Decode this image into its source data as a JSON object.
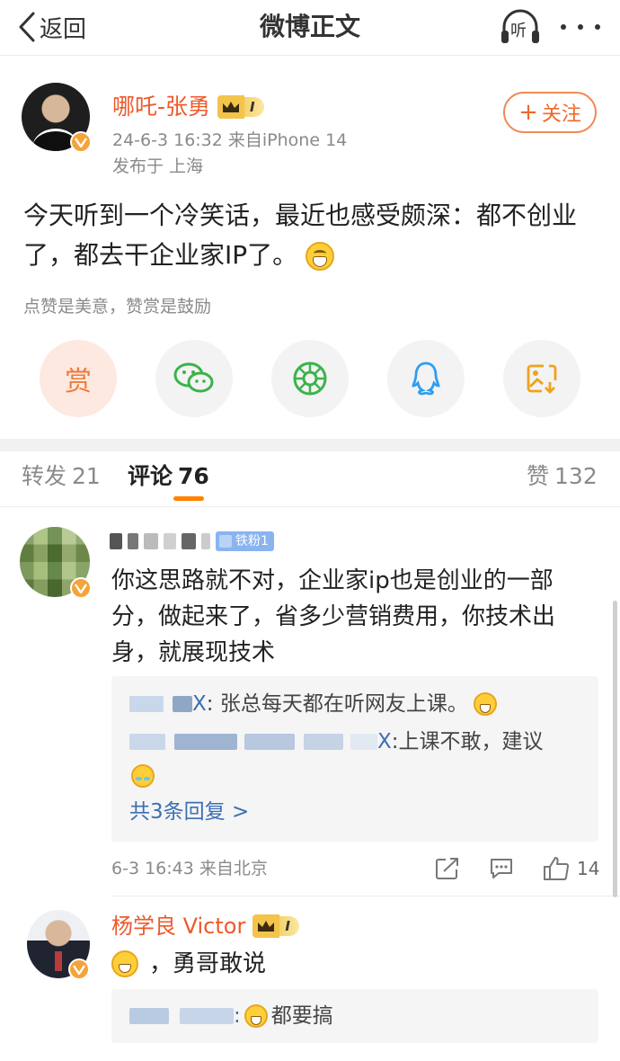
{
  "navbar": {
    "back_label": "返回",
    "title": "微博正文",
    "listen_label": "听"
  },
  "post": {
    "author": "哪吒-张勇",
    "level_badge": "I",
    "follow_label": "关注",
    "meta": "24-6-3 16:32  来自iPhone 14",
    "location": "发布于 上海",
    "body": "今天听到一个冷笑话，最近也感受颇深：都不创业了，都去干企业家IP了。",
    "reward_hint": "点赞是美意，赞赏是鼓励"
  },
  "share": {
    "reward_label": "赏",
    "items": [
      "wechat-icon",
      "moments-icon",
      "qq-icon",
      "save-image-icon"
    ]
  },
  "tabs": {
    "repost_label": "转发",
    "repost_count": "21",
    "comment_label": "评论",
    "comment_count": "76",
    "like_label": "赞",
    "like_count": "132"
  },
  "comments": [
    {
      "fan_badge": "铁粉1",
      "text": "你这思路就不对，企业家ip也是创业的一部分，做起来了，省多少营销费用，你技术出身，就展现技术",
      "replies": [
        {
          "name_tail": "X",
          "text": ": 张总每天都在听网友上课。"
        },
        {
          "name_tail": "X",
          "text": ":上课不敢，建议"
        }
      ],
      "more_replies": "共3条回复 >",
      "meta": "6-3 16:43  来自北京",
      "likes": "14"
    },
    {
      "author": "杨学良 Victor",
      "level_badge": "I",
      "text": "，勇哥敢说",
      "reply": {
        "text": "都要搞"
      }
    }
  ],
  "colors": {
    "accent": "#ff8200",
    "name_orange": "#ec5a2b",
    "link_blue": "#3c6fb3",
    "meta_gray": "#8a8a8a"
  }
}
